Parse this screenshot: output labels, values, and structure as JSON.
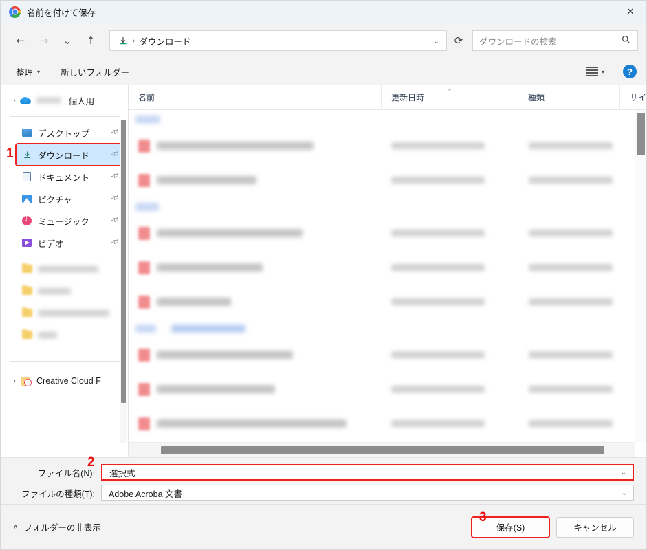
{
  "window": {
    "title": "名前を付けて保存",
    "app_icon": "chrome-icon",
    "close_label": "✕"
  },
  "nav": {
    "back": "←",
    "forward": "→",
    "recent": "⌄",
    "up": "↑",
    "breadcrumb_icon": "download-icon",
    "breadcrumb_label": "ダウンロード",
    "breadcrumb_separator": "›",
    "address_chevron": "⌄",
    "refresh": "⟳"
  },
  "search": {
    "placeholder": "ダウンロードの検索",
    "icon": "search-icon"
  },
  "toolbar": {
    "organize_label": "整理",
    "organize_caret": "▾",
    "new_folder_label": "新しいフォルダー",
    "view_caret": "▾",
    "help_label": "?"
  },
  "sidebar": {
    "expander": "›",
    "pin": "📌",
    "items": [
      {
        "label": "- 個人用",
        "icon": "onedrive-icon",
        "expander": true,
        "blurred_prefix": true,
        "pinned": false,
        "selected": false
      },
      {
        "label": "デスクトップ",
        "icon": "desktop-icon",
        "expander": false,
        "pinned": true,
        "selected": false
      },
      {
        "label": "ダウンロード",
        "icon": "download-icon",
        "expander": false,
        "pinned": true,
        "selected": true
      },
      {
        "label": "ドキュメント",
        "icon": "documents-icon",
        "expander": false,
        "pinned": true,
        "selected": false
      },
      {
        "label": "ピクチャ",
        "icon": "pictures-icon",
        "expander": false,
        "pinned": true,
        "selected": false
      },
      {
        "label": "ミュージック",
        "icon": "music-icon",
        "expander": false,
        "pinned": true,
        "selected": false
      },
      {
        "label": "ビデオ",
        "icon": "videos-icon",
        "expander": false,
        "pinned": true,
        "selected": false
      }
    ],
    "redacted_folders": [
      {
        "icon": "folder-icon",
        "width_class": "w1"
      },
      {
        "icon": "folder-icon",
        "width_class": "w2"
      },
      {
        "icon": "folder-icon",
        "width_class": "w3"
      },
      {
        "icon": "folder-icon",
        "width_class": "w4"
      }
    ],
    "creative_cloud": {
      "label": "Creative Cloud F",
      "icon": "creative-cloud-folder-icon",
      "expander": "›"
    }
  },
  "filelist": {
    "columns": [
      {
        "label": "名前",
        "key": "name"
      },
      {
        "label": "更新日時",
        "key": "date",
        "sorted": true,
        "sort_chevron": "⌄"
      },
      {
        "label": "種類",
        "key": "type"
      },
      {
        "label": "サイズ",
        "key": "size"
      }
    ],
    "rows": [
      {
        "kind": "group",
        "chip": "g1"
      },
      {
        "kind": "file",
        "name_width": 228,
        "redacted": true
      },
      {
        "kind": "file",
        "name_width": 145,
        "redacted": true
      },
      {
        "kind": "group",
        "chip": "g2"
      },
      {
        "kind": "file",
        "name_width": 212,
        "redacted": true
      },
      {
        "kind": "file",
        "name_width": 154,
        "redacted": true
      },
      {
        "kind": "file",
        "name_width": 108,
        "redacted": true
      },
      {
        "kind": "group",
        "chip": "g3",
        "extra_chip": true
      },
      {
        "kind": "file",
        "name_width": 198,
        "redacted": true
      },
      {
        "kind": "file",
        "name_width": 172,
        "redacted": true
      },
      {
        "kind": "file",
        "name_width": 276,
        "redacted": true
      },
      {
        "kind": "file",
        "name_width": 272,
        "redacted": true
      },
      {
        "kind": "file",
        "name_width": 104,
        "redacted": true
      },
      {
        "kind": "group",
        "chip": "g1"
      }
    ]
  },
  "form": {
    "filename_label": "ファイル名(N):",
    "filename_value": "選択式",
    "filetype_label": "ファイルの種類(T):",
    "filetype_value": "Adobe Acroba 文書",
    "chevron": "⌄"
  },
  "footer": {
    "hide_folders_caret": "∧",
    "hide_folders_label": "フォルダーの非表示",
    "save_label": "保存(S)",
    "cancel_label": "キャンセル"
  },
  "annotations": {
    "marker_1": "1",
    "marker_2": "2",
    "marker_3": "3",
    "color": "#e81010"
  }
}
